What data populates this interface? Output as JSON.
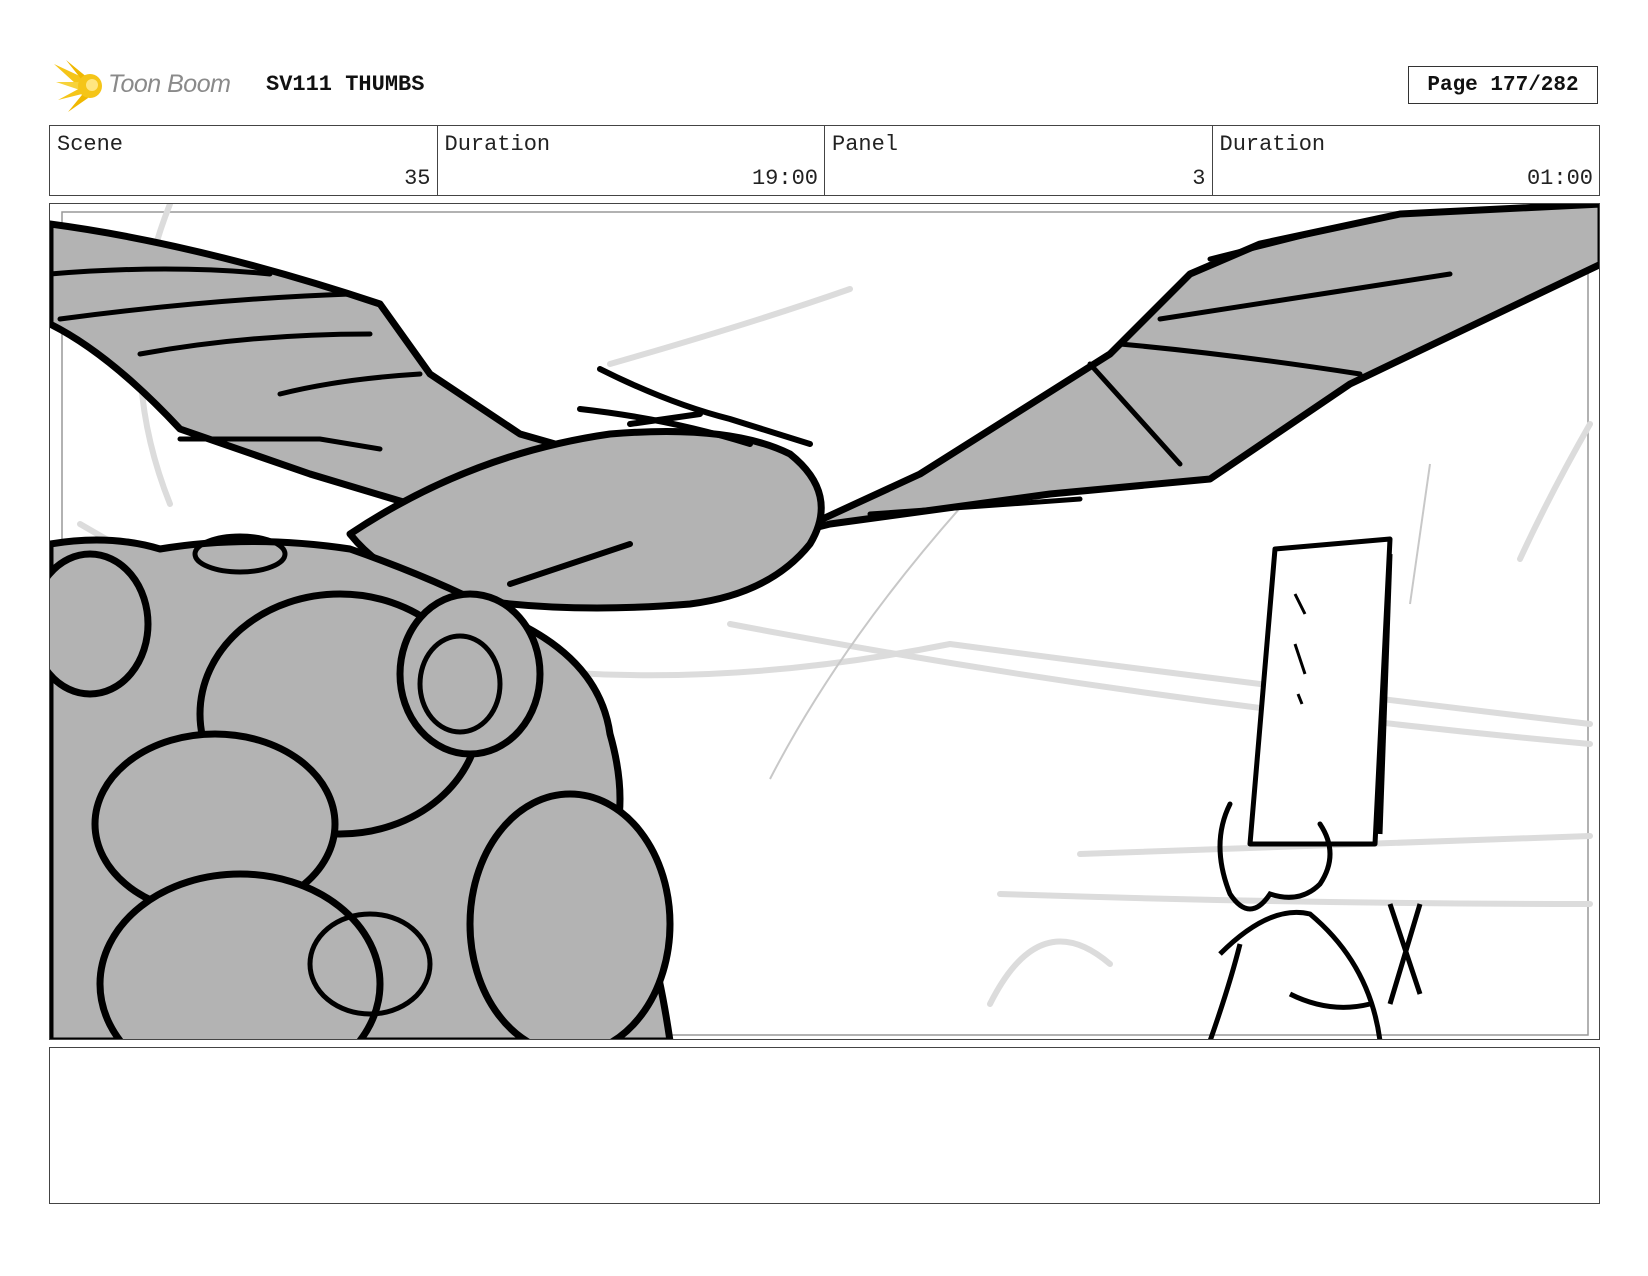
{
  "header": {
    "logo_text": "Toon Boom",
    "doc_title": "SV111 THUMBS",
    "page_label": "Page 177/282"
  },
  "info": [
    {
      "label": "Scene",
      "value": "35"
    },
    {
      "label": "Duration",
      "value": "19:00"
    },
    {
      "label": "Panel",
      "value": "3"
    },
    {
      "label": "Duration",
      "value": "01:00"
    }
  ],
  "colors": {
    "logo_yellow": "#f5c518",
    "sketch_fill": "#b3b3b3",
    "sketch_line": "#000000",
    "guide_line": "#d9d9d9"
  },
  "notes": ""
}
